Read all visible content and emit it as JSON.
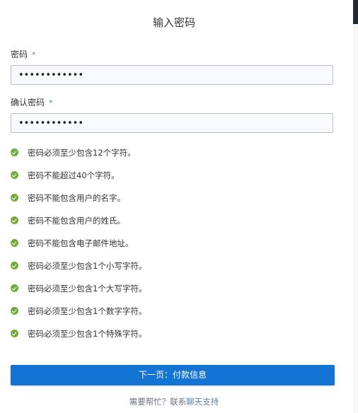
{
  "title": "输入密码",
  "password_field": {
    "label": "密码",
    "required_mark": "*",
    "masked_value": "••••••••••••"
  },
  "confirm_field": {
    "label": "确认密码",
    "required_mark": "*",
    "masked_value": "••••••••••••"
  },
  "rules": [
    "密码必须至少包含12个字符。",
    "密码不能超过40个字符。",
    "密码不能包含用户的名字。",
    "密码不能包含用户的姓氏。",
    "密码不能包含电子邮件地址。",
    "密码必须至少包含1个小写字符。",
    "密码必须至少包含1个大写字符。",
    "密码必须至少包含1个数字字符。",
    "密码必须至少包含1个特殊字符。"
  ],
  "next_button": "下一页：付款信息",
  "help": {
    "prefix": "需要帮忙？联系",
    "link": "聊天支持"
  },
  "colors": {
    "primary": "#1474d4",
    "check": "#77a83c",
    "link": "#5a7fa8"
  }
}
